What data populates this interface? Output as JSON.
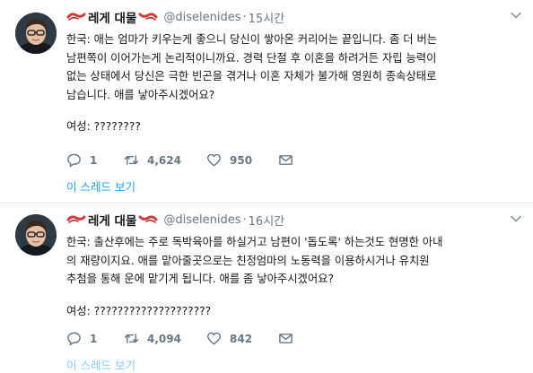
{
  "tweets": [
    {
      "display_name": "레게 대물",
      "handle": "@diselenides",
      "separator": "·",
      "time": "15시간",
      "lines": [
        "한국: 애는 엄마가 키우는게 좋으니 당신이 쌓아온 커리어는 끝입니다. 좀 더 버는",
        "남편쪽이 이어가는게 논리적이니까요. 경력 단절 후 이혼을 하려거든 자립 능력이",
        "없는 상태에서 당신은 극한 빈곤을 겪거나 이혼 자체가 불가해 영원히 종속상태로",
        "남습니다. 애를 낳아주시겠어요?"
      ],
      "reply_line": "여성: ????????",
      "reply_count": "1",
      "retweet_count": "4,624",
      "like_count": "950",
      "thread_link": "이 스레드 보기"
    },
    {
      "display_name": "레게 대물",
      "handle": "@diselenides",
      "separator": "·",
      "time": "16시간",
      "lines": [
        "한국: 출산후에는 주로 독박육아를 하실거고 남편이 '돕도록' 하는것도 현명한 아내",
        "의 재량이지요. 애를 맡아줄곳으로는 친정엄마의 노동력을 이용하시거나 유치원",
        "추첨을 통해 운에 맡기게 됩니다. 애를 좀 낳아주시겠어요?"
      ],
      "reply_line": "여성: ????????????????????",
      "reply_count": "1",
      "retweet_count": "4,094",
      "like_count": "842",
      "thread_link": "이 스레드 보기"
    }
  ],
  "icons": {
    "flag": "korea-flag-emoji-icon",
    "caret": "chevron-down-icon",
    "reply": "reply-icon",
    "retweet": "retweet-icon",
    "like": "heart-icon",
    "dm": "envelope-icon"
  },
  "colors": {
    "link": "#1da1f2",
    "muted": "#657786",
    "text": "#14171a",
    "flag_red": "#d23a3a"
  }
}
